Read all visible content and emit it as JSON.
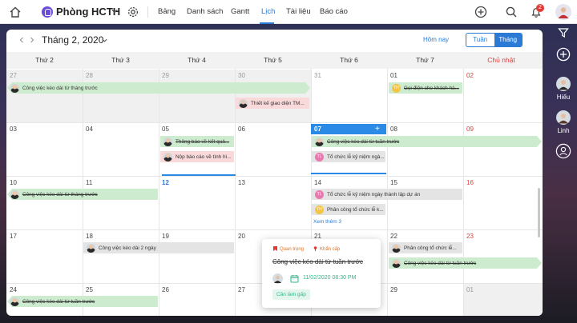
{
  "topbar": {
    "project_title": "Phòng HCTH",
    "tabs": [
      {
        "label": "Bảng"
      },
      {
        "label": "Danh sách"
      },
      {
        "label": "Gantt"
      },
      {
        "label": "Lịch"
      },
      {
        "label": "Tài liệu"
      },
      {
        "label": "Báo cáo"
      }
    ],
    "active_tab": "Lịch",
    "notification_count": "2"
  },
  "sidebar": {
    "users": [
      {
        "name": "Hiếu"
      },
      {
        "name": "Linh"
      }
    ]
  },
  "calendar": {
    "month_label": "Tháng 2, 2020",
    "today_label": "Hôm nay",
    "view_week": "Tuần",
    "view_month": "Tháng",
    "weekdays": [
      "Thứ 2",
      "Thứ 3",
      "Thứ 4",
      "Thứ 5",
      "Thứ 6",
      "Thứ 7",
      "Chủ nhật"
    ],
    "weeks": [
      [
        "27",
        "28",
        "29",
        "30",
        "31",
        "01",
        "02"
      ],
      [
        "03",
        "04",
        "05",
        "06",
        "07",
        "08",
        "09"
      ],
      [
        "10",
        "11",
        "12",
        "13",
        "14",
        "15",
        "16"
      ],
      [
        "17",
        "18",
        "19",
        "20",
        "21",
        "22",
        "23"
      ],
      [
        "24",
        "25",
        "26",
        "27",
        "28",
        "29",
        "01"
      ]
    ],
    "today": "07",
    "events": {
      "e1": "Công việc kéo dài từ tháng trước",
      "e2": "Gọi điện cho khách hà...",
      "e3": "Thiết kế giao diện TM...",
      "e4": "Thông báo về kết quả...",
      "e5": "Nộp báo cáo về tình hì...",
      "e6": "Công việc kéo dài từ tuần trước",
      "e7": "Tổ chức lễ kỷ niệm ngà...",
      "e8": "Công việc kéo dài từ tháng trước",
      "e9": "Tổ chức lễ kỷ niệm ngày thành lập dự án",
      "e10": "Phân công tổ chức lễ k...",
      "e11": "Công việc kéo dài 2 ngày",
      "e12": "Phân công tổ chức lễ...",
      "e13": "Công việc kéo dài từ tuần trước",
      "e14": "Công việc kéo dài từ tuần trước"
    },
    "avatar_initials": {
      "tl": "TL",
      "th": "TH"
    },
    "more_label": "Xem thêm 3"
  },
  "popup": {
    "tag_important": "Quan trọng",
    "tag_urgent": "Khẩn cấp",
    "title": "Công việc kéo dài từ tuần trước",
    "datetime": "11/02/2020 08:30 PM",
    "button": "Cần làm gấp"
  }
}
